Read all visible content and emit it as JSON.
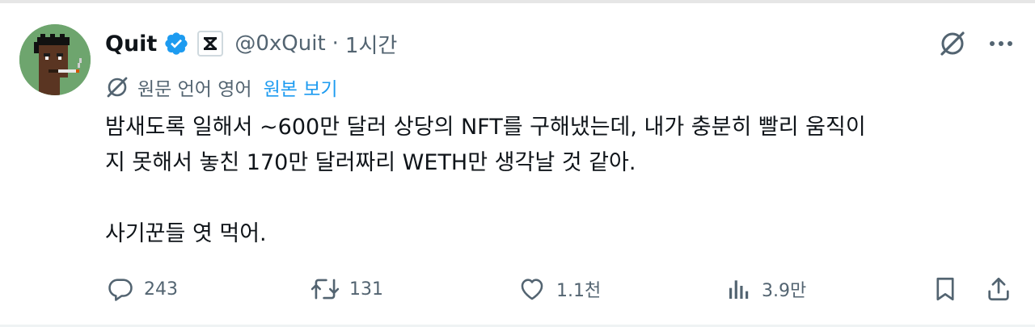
{
  "tweet": {
    "author": {
      "name": "Quit",
      "handle": "@0xQuit",
      "separator": "·",
      "time": "1시간"
    },
    "translation": {
      "label": "원문 언어 영어",
      "link": "원본 보기"
    },
    "text": "밤새도록 일해서 ~600만 달러 상당의 NFT를 구해냈는데, 내가 충분히 빨리 움직이\n지 못해서 놓친 170만 달러짜리 WETH만 생각날 것 같아.\n\n사기꾼들 엿 먹어.",
    "metrics": {
      "replies": "243",
      "reposts": "131",
      "likes": "1.1천",
      "views": "3.9만"
    }
  },
  "colors": {
    "accent": "#1d9bf0",
    "muted": "#536471",
    "text": "#0f1419",
    "avatar_bg": "#6ea56e"
  },
  "icons": [
    "verified-badge-icon",
    "affiliate-badge-icon",
    "grok-icon",
    "more-icon",
    "translate-icon",
    "reply-icon",
    "repost-icon",
    "like-icon",
    "views-icon",
    "bookmark-icon",
    "share-icon"
  ]
}
